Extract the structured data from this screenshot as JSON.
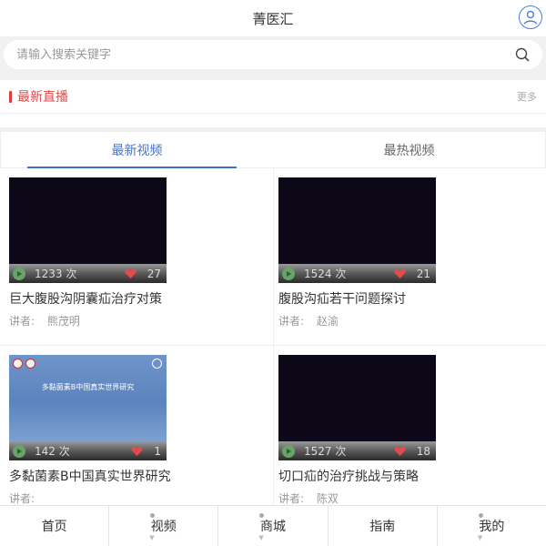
{
  "header": {
    "title": "菁医汇",
    "user_icon": "user-circle-icon"
  },
  "search": {
    "placeholder": "请输入搜索关键字",
    "icon": "search-icon"
  },
  "live": {
    "title": "最新直播",
    "more": "更多",
    "accent": "#e03b3b"
  },
  "tabs": [
    {
      "label": "最新视频",
      "active": true
    },
    {
      "label": "最热视频",
      "active": false
    }
  ],
  "videos": [
    {
      "title": "巨大腹股沟阴囊疝治疗对策",
      "views": "1233 次",
      "likes": "27",
      "lecturer_label": "讲者:",
      "lecturer": "熊茂明"
    },
    {
      "title": "腹股沟疝若干问题探讨",
      "views": "1524 次",
      "likes": "21",
      "lecturer_label": "讲者:",
      "lecturer": "赵渝"
    },
    {
      "title": "多黏菌素B中国真实世界研究",
      "views": "142 次",
      "likes": "1",
      "lecturer_label": "讲者:",
      "lecturer": "",
      "slide_title": "多黏菌素B中国真实世界研究"
    },
    {
      "title": "切口疝的治疗挑战与策略",
      "views": "1527 次",
      "likes": "18",
      "lecturer_label": "讲者:",
      "lecturer": "陈双"
    }
  ],
  "nav": [
    {
      "label": "首页"
    },
    {
      "label": "视频"
    },
    {
      "label": "商城"
    },
    {
      "label": "指南"
    },
    {
      "label": "我的"
    }
  ],
  "colors": {
    "tab_active": "#4a73c9",
    "thumb_dark": "#0c0818",
    "play": "#6aa36a",
    "heart": "#e34b4b"
  }
}
